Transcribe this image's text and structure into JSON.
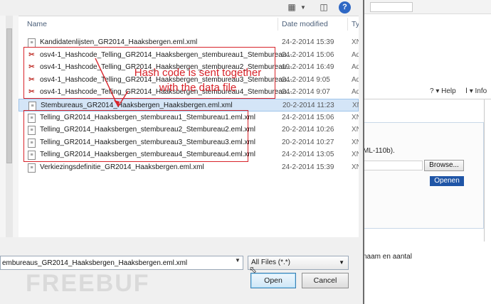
{
  "toolbar": {
    "view_icon": "view-icon",
    "preview_icon": "preview-pane-icon",
    "help_icon": "help-icon",
    "help_glyph": "?"
  },
  "columns": {
    "name": "Name",
    "date_modified": "Date modified",
    "type": "Ty"
  },
  "files": [
    {
      "icon": "xml-file-icon",
      "name": "Kandidatenlijsten_GR2014_Haaksbergen.eml.xml",
      "date": "24-2-2014 15:39",
      "type": "XN",
      "selected": false
    },
    {
      "icon": "pdf-file-icon",
      "name": "osv4-1_Hashcode_Telling_GR2014_Haaksbergen_stembureau1_Stembureau...",
      "date": "24-2-2014 15:06",
      "type": "Ad",
      "selected": false
    },
    {
      "icon": "pdf-file-icon",
      "name": "osv4-1_Hashcode_Telling_GR2014_Haaksbergen_stembureau2_Stembureau...",
      "date": "19-2-2014 16:49",
      "type": "Ad",
      "selected": false
    },
    {
      "icon": "pdf-file-icon",
      "name": "osv4-1_Hashcode_Telling_GR2014_Haaksbergen_stembureau3_Stembureau...",
      "date": "24-2-2014 9:05",
      "type": "Ad",
      "selected": false
    },
    {
      "icon": "pdf-file-icon",
      "name": "osv4-1_Hashcode_Telling_GR2014_Haaksbergen_stembureau4_Stembureau...",
      "date": "24-2-2014 9:07",
      "type": "Ad",
      "selected": false
    },
    {
      "icon": "xml-file-icon",
      "name": "Stembureaus_GR2014_Haaksbergen_Haaksbergen.eml.xml",
      "date": "20-2-2014 11:23",
      "type": "XN",
      "selected": true
    },
    {
      "icon": "xml-file-icon",
      "name": "Telling_GR2014_Haaksbergen_stembureau1_Stembureau1.eml.xml",
      "date": "24-2-2014 15:06",
      "type": "XN",
      "selected": false
    },
    {
      "icon": "xml-file-icon",
      "name": "Telling_GR2014_Haaksbergen_stembureau2_Stembureau2.eml.xml",
      "date": "20-2-2014 10:26",
      "type": "XN",
      "selected": false
    },
    {
      "icon": "xml-file-icon",
      "name": "Telling_GR2014_Haaksbergen_stembureau3_Stembureau3.eml.xml",
      "date": "20-2-2014 10:27",
      "type": "XN",
      "selected": false
    },
    {
      "icon": "xml-file-icon",
      "name": "Telling_GR2014_Haaksbergen_stembureau4_Stembureau4.eml.xml",
      "date": "24-2-2014 13:05",
      "type": "XN",
      "selected": false
    },
    {
      "icon": "xml-file-icon",
      "name": "Verkiezingsdefinitie_GR2014_Haaksbergen.eml.xml",
      "date": "24-2-2014 15:39",
      "type": "XN",
      "selected": false
    }
  ],
  "annotation": {
    "line1": "Hash code is sent together",
    "line2": "with the data file",
    "color": "#d8232a"
  },
  "bottom": {
    "filename_value": "embureaus_GR2014_Haaksbergen_Haaksbergen.eml.xml",
    "filter_value": "All Files (*.*)",
    "open_label": "Open",
    "cancel_label": "Cancel"
  },
  "background_app": {
    "help_label": "? ▾ Help",
    "info_label": "Ⅰ ▾ Info",
    "ml_text": "ML-110b).",
    "browse_label": "Browse...",
    "openen_label": "Openen",
    "naam_text": "naam en aantal",
    "accent_color": "#1f55a6"
  },
  "watermark": "FREEBUF"
}
